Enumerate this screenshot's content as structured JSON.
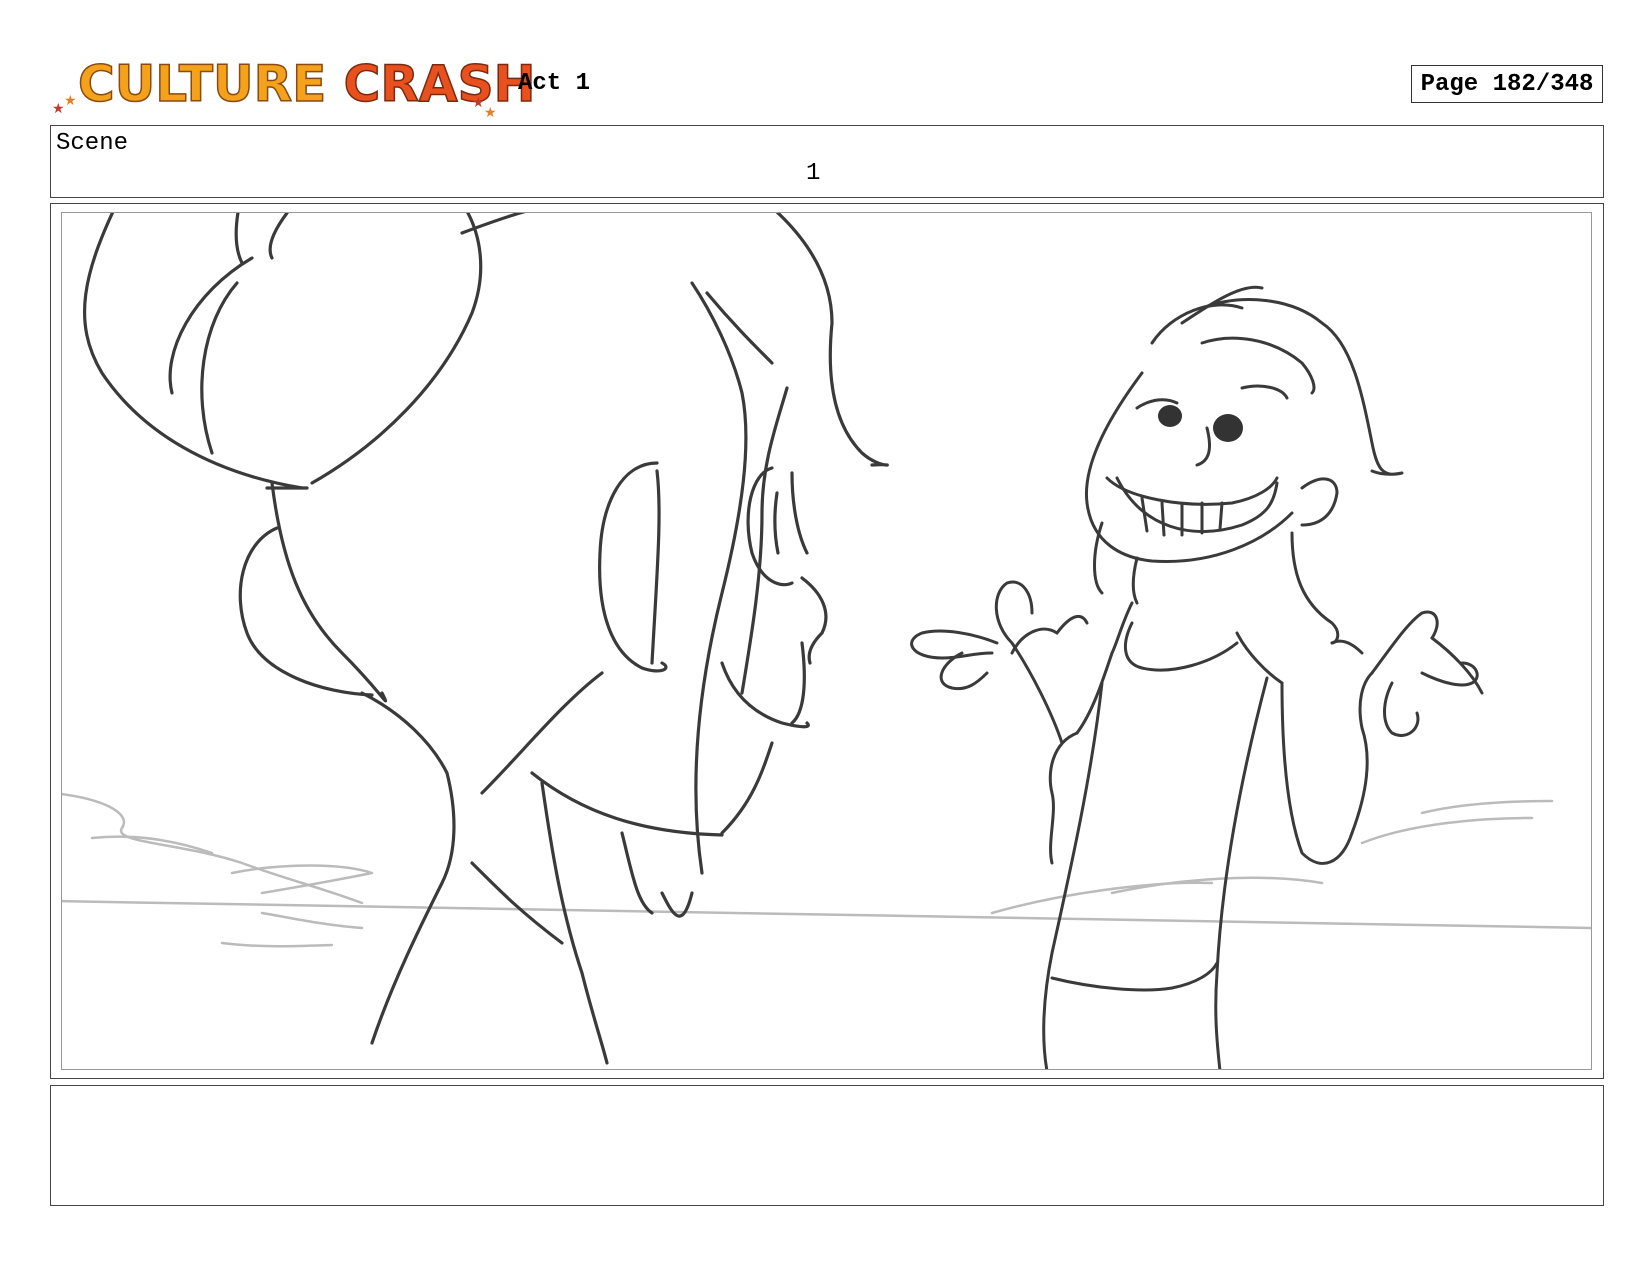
{
  "header": {
    "logo": {
      "word1": "CULTURE",
      "word2": "CRASH"
    },
    "act": "Act 1",
    "page": "Page 182/348"
  },
  "scene": {
    "label": "Scene",
    "number": "1"
  },
  "panel": {
    "drawing": "sketch-artwork"
  },
  "notes": {
    "text": ""
  },
  "colors": {
    "logo_orange": "#f4a21c",
    "logo_red": "#e8501e",
    "sketch_line": "#3a3a3a",
    "sketch_light": "#b8b8b8"
  }
}
